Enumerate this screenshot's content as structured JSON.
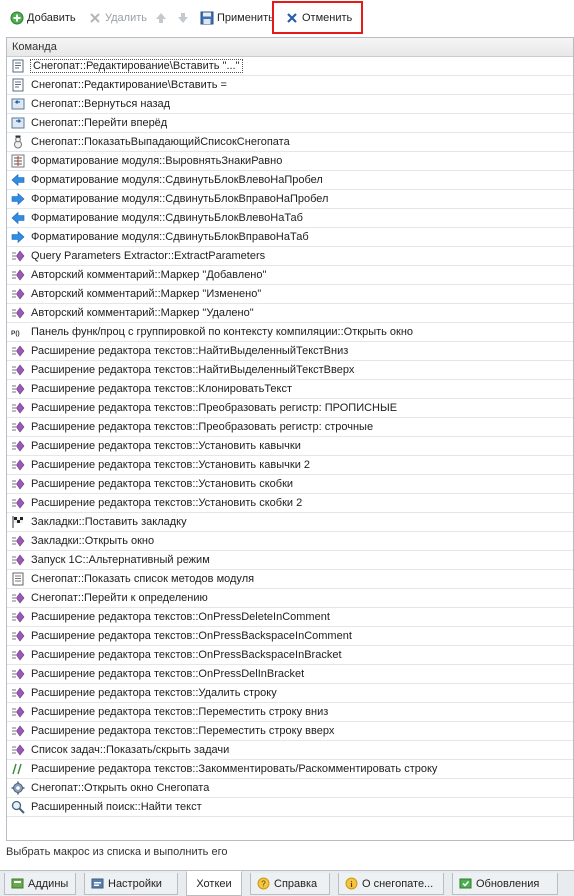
{
  "toolbar": {
    "add_label": "Добавить",
    "delete_label": "Удалить",
    "apply_label": "Применить",
    "cancel_label": "Отменить"
  },
  "grid": {
    "column_header": "Команда",
    "rows": [
      {
        "text": "Снегопат::Редактирование\\Вставить \"...\"",
        "icon": "notepad-icon"
      },
      {
        "text": "Снегопат::Редактирование\\Вставить =",
        "icon": "notepad-icon"
      },
      {
        "text": "Снегопат::Вернуться назад",
        "icon": "nav-back-icon"
      },
      {
        "text": "Снегопат::Перейти вперёд",
        "icon": "nav-forward-icon"
      },
      {
        "text": "Снегопат::ПоказатьВыпадающийСписокСнегопата",
        "icon": "snowman-icon"
      },
      {
        "text": "Форматирование модуля::ВыровнятьЗнакиРавно",
        "icon": "align-icon"
      },
      {
        "text": "Форматирование модуля::СдвинутьБлокВлевоНаПробел",
        "icon": "arrow-left-icon"
      },
      {
        "text": "Форматирование модуля::СдвинутьБлокВправоНаПробел",
        "icon": "arrow-right-icon"
      },
      {
        "text": "Форматирование модуля::СдвинутьБлокВлевоНаТаб",
        "icon": "arrow-left-icon"
      },
      {
        "text": "Форматирование модуля::СдвинутьБлокВправоНаТаб",
        "icon": "arrow-right-icon"
      },
      {
        "text": "Query Parameters Extractor::ExtractParameters",
        "icon": "macro-icon"
      },
      {
        "text": "Авторский комментарий::Маркер \"Добавлено\"",
        "icon": "macro-icon"
      },
      {
        "text": "Авторский комментарий::Маркер \"Изменено\"",
        "icon": "macro-icon"
      },
      {
        "text": "Авторский комментарий::Маркер \"Удалено\"",
        "icon": "macro-icon"
      },
      {
        "text": "Панель функ/проц с группировкой по контексту компиляции::Открыть окно",
        "icon": "proc-icon"
      },
      {
        "text": "Расширение редактора текстов::НайтиВыделенныйТекстВниз",
        "icon": "macro-icon"
      },
      {
        "text": "Расширение редактора текстов::НайтиВыделенныйТекстВверх",
        "icon": "macro-icon"
      },
      {
        "text": "Расширение редактора текстов::КлонироватьТекст",
        "icon": "macro-icon"
      },
      {
        "text": "Расширение редактора текстов::Преобразовать регистр: ПРОПИСНЫЕ",
        "icon": "macro-icon"
      },
      {
        "text": "Расширение редактора текстов::Преобразовать регистр: строчные",
        "icon": "macro-icon"
      },
      {
        "text": "Расширение редактора текстов::Установить кавычки",
        "icon": "macro-icon"
      },
      {
        "text": "Расширение редактора текстов::Установить кавычки 2",
        "icon": "macro-icon"
      },
      {
        "text": "Расширение редактора текстов::Установить скобки",
        "icon": "macro-icon"
      },
      {
        "text": "Расширение редактора текстов::Установить скобки 2",
        "icon": "macro-icon"
      },
      {
        "text": "Закладки::Поставить закладку",
        "icon": "checkered-flag-icon"
      },
      {
        "text": "Закладки::Открыть окно",
        "icon": "macro-icon"
      },
      {
        "text": "Запуск 1С::Альтернативный режим",
        "icon": "macro-icon"
      },
      {
        "text": "Снегопат::Показать список методов модуля",
        "icon": "list-icon"
      },
      {
        "text": "Снегопат::Перейти к определению",
        "icon": "macro-icon"
      },
      {
        "text": "Расширение редактора текстов::OnPressDeleteInComment",
        "icon": "macro-icon"
      },
      {
        "text": "Расширение редактора текстов::OnPressBackspaceInComment",
        "icon": "macro-icon"
      },
      {
        "text": "Расширение редактора текстов::OnPressBackspaceInBracket",
        "icon": "macro-icon"
      },
      {
        "text": "Расширение редактора текстов::OnPressDelInBracket",
        "icon": "macro-icon"
      },
      {
        "text": "Расширение редактора текстов::Удалить строку",
        "icon": "macro-icon"
      },
      {
        "text": "Расширение редактора текстов::Переместить строку вниз",
        "icon": "macro-icon"
      },
      {
        "text": "Расширение редактора текстов::Переместить строку вверх",
        "icon": "macro-icon"
      },
      {
        "text": "Список задач::Показать/скрыть задачи",
        "icon": "macro-icon"
      },
      {
        "text": "Расширение редактора текстов::Закомментировать/Раскомментировать строку",
        "icon": "comment-slashes-icon"
      },
      {
        "text": "Снегопат::Открыть окно Снегопата",
        "icon": "gear-icon"
      },
      {
        "text": "Расширенный поиск::Найти текст",
        "icon": "search-icon"
      }
    ]
  },
  "status_text": "Выбрать макрос из списка и выполнить его",
  "tabs": [
    {
      "label": "Аддины",
      "icon": "addins-icon"
    },
    {
      "label": "Настройки",
      "icon": "settings-icon"
    },
    {
      "label": "Хоткеи",
      "icon": "none"
    },
    {
      "label": "Справка",
      "icon": "help-icon"
    },
    {
      "label": "О снегопате...",
      "icon": "info-icon"
    },
    {
      "label": "Обновления",
      "icon": "updates-icon"
    }
  ],
  "colors": {
    "highlight_box": "#e41b1b",
    "macro_icon": "#9b59b6",
    "arrow_icon": "#2f8de4"
  }
}
